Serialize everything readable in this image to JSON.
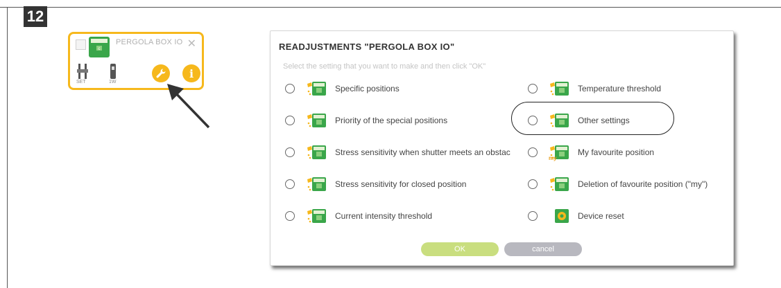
{
  "step": {
    "number": "12"
  },
  "tile": {
    "title": "PERGOLA BOX IO",
    "close_glyph": "✕",
    "sub1_label": "SET",
    "sub2_label": "1W",
    "wrench_icon": "wrench-icon",
    "info_glyph": "i"
  },
  "dialog": {
    "title": "READJUSTMENTS \"PERGOLA BOX IO\"",
    "subtitle": "Select the setting that you want to make and then click \"OK\"",
    "left_options": [
      {
        "label": "Specific positions",
        "icon": "specific-positions-icon"
      },
      {
        "label": "Priority of the special positions",
        "icon": "priority-icon"
      },
      {
        "label": "Stress sensitivity when shutter meets an obstac",
        "icon": "stress-obstacle-icon"
      },
      {
        "label": "Stress sensitivity for closed position",
        "icon": "stress-closed-icon"
      },
      {
        "label": "Current intensity threshold",
        "icon": "current-threshold-icon"
      }
    ],
    "right_options": [
      {
        "label": "Temperature threshold",
        "icon": "temperature-icon"
      },
      {
        "label": "Other settings",
        "icon": "other-settings-icon"
      },
      {
        "label": "My favourite position",
        "icon": "favourite-position-icon",
        "tag": "my"
      },
      {
        "label": "Deletion of favourite position (\"my\")",
        "icon": "delete-favourite-icon"
      },
      {
        "label": "Device reset",
        "icon": "device-reset-icon"
      }
    ],
    "ok_label": "OK",
    "cancel_label": "cancel"
  },
  "colors": {
    "accent_orange": "#f6b81c",
    "icon_green": "#3aa64a",
    "ok_green": "#c9de7f",
    "cancel_gray": "#b8b8bf"
  }
}
